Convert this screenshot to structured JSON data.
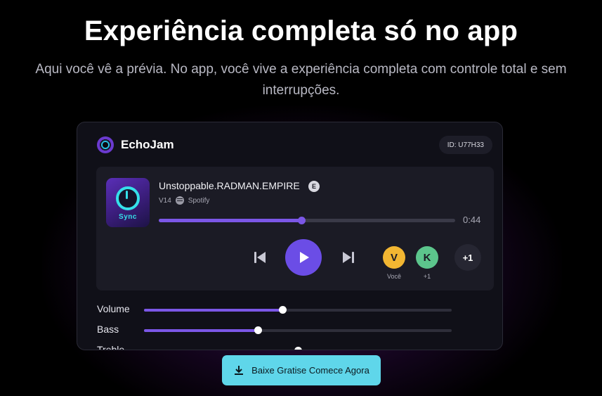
{
  "hero": {
    "title": "Experiência completa só no app",
    "subtitle": "Aqui você vê a prévia. No app, você vive a experiência completa com controle total e sem interrupções."
  },
  "app": {
    "name": "EchoJam",
    "logo_icon": "echojam-logo-icon",
    "session_id": "ID: U77H33"
  },
  "player": {
    "artwork_label": "Sync",
    "track_title": "Unstoppable.RADMAN.EMPIRE",
    "explicit_badge": "E",
    "version": "V14",
    "source": "Spotify",
    "source_icon": "spotify-icon",
    "progress": 0.48,
    "elapsed": "0:44",
    "controls": {
      "prev_icon": "skip-previous-icon",
      "play_icon": "play-icon",
      "next_icon": "skip-next-icon"
    },
    "listeners": [
      {
        "initial": "V",
        "label": "Você",
        "color": "#f2b632"
      },
      {
        "initial": "K",
        "label": "+1",
        "color": "#5cc58c"
      }
    ],
    "more_listeners": "+1"
  },
  "eq": {
    "sliders": [
      {
        "label": "Volume",
        "value": 0.45
      },
      {
        "label": "Bass",
        "value": 0.37
      },
      {
        "label": "Treble",
        "value": 0.5
      }
    ]
  },
  "cta": {
    "label": "Baixe Gratise Comece Agora",
    "icon": "download-icon"
  },
  "colors": {
    "accent": "#6b4de6",
    "cta": "#5fd6ea",
    "card": "#101018"
  }
}
